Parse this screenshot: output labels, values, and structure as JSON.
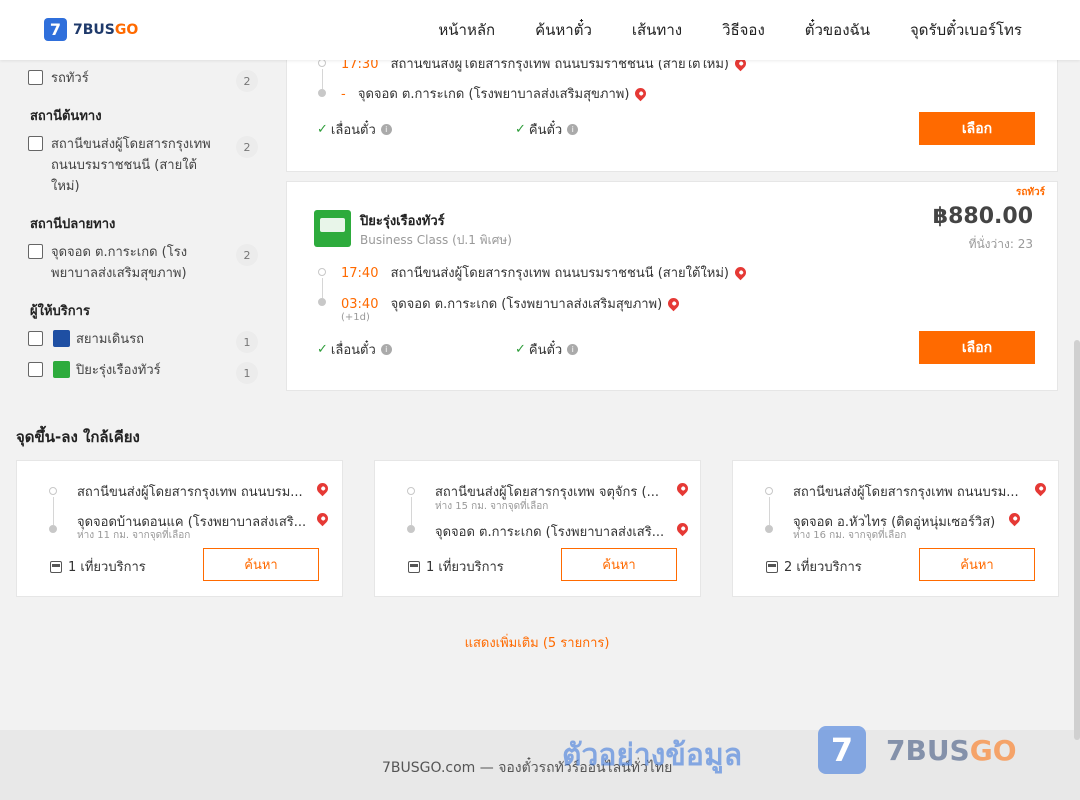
{
  "header": {
    "logo_badge": "7",
    "logo_text_main": "7BUS",
    "logo_text_accent": "GO",
    "nav": [
      "หน้าหลัก",
      "ค้นหาตั๋ว",
      "เส้นทาง",
      "วิธีจอง",
      "ตั๋วของฉัน",
      "จุดรับตั๋วเบอร์โทร"
    ]
  },
  "filters": {
    "type_item": {
      "label": "รถทัวร์",
      "count": "2"
    },
    "origin_title": "สถานีต้นทาง",
    "origin_item": {
      "label": "สถานีขนส่งผู้โดยสารกรุงเทพ ถนนบรมราชชนนี (สายใต้ใหม่)",
      "count": "2"
    },
    "dest_title": "สถานีปลายทาง",
    "dest_item": {
      "label": "จุดจอด ต.การะเกด (โรงพยาบาลส่งเสริมสุขภาพ)",
      "count": "2"
    },
    "operator_title": "ผู้ให้บริการ",
    "operators": [
      {
        "label": "สยามเดินรถ",
        "count": "1"
      },
      {
        "label": "ปิยะรุ่งเรืองทัวร์",
        "count": "1"
      }
    ]
  },
  "card1": {
    "depart_time": "17:30",
    "depart_stop": "สถานีขนส่งผู้โดยสารกรุงเทพ ถนนบรมราชชนนี (สายใต้ใหม่)",
    "arrive_time": "-",
    "arrive_stop": "จุดจอด ต.การะเกด (โรงพยาบาลส่งเสริมสุขภาพ)",
    "feature_reschedule": "เลื่อนตั๋ว",
    "feature_refund": "คืนตั๋ว",
    "select_label": "เลือก"
  },
  "card2": {
    "tag": "รถทัวร์",
    "operator": "ปิยะรุ่งเรืองทัวร์",
    "class": "Business Class (ป.1 พิเศษ)",
    "price": "฿880.00",
    "seats": "ที่นั่งว่าง: 23",
    "depart_time": "17:40",
    "depart_stop": "สถานีขนส่งผู้โดยสารกรุงเทพ ถนนบรมราชชนนี (สายใต้ใหม่)",
    "arrive_time": "03:40",
    "arrive_note": "(+1d)",
    "arrive_stop": "จุดจอด ต.การะเกด (โรงพยาบาลส่งเสริมสุขภาพ)",
    "feature_reschedule": "เลื่อนตั๋ว",
    "feature_refund": "คืนตั๋ว",
    "select_label": "เลือก"
  },
  "nearby": {
    "title": "จุดขึ้น-ลง ใกล้เคียง",
    "search_label": "ค้นหา",
    "cards": [
      {
        "from": "สถานีขนส่งผู้โดยสารกรุงเทพ ถนนบรม...",
        "from_dist": "",
        "to": "จุดจอดบ้านดอนแค (โรงพยาบาลส่งเสริ...",
        "to_dist": "ห่าง 11 กม. จากจุดที่เลือก",
        "trips": "1 เที่ยวบริการ"
      },
      {
        "from": "สถานีขนส่งผู้โดยสารกรุงเทพ จตุจักร (...",
        "from_dist": "ห่าง 15 กม. จากจุดที่เลือก",
        "to": "จุดจอด ต.การะเกด (โรงพยาบาลส่งเสริ...",
        "to_dist": "",
        "trips": "1 เที่ยวบริการ"
      },
      {
        "from": "สถานีขนส่งผู้โดยสารกรุงเทพ ถนนบรม...",
        "from_dist": "",
        "to": "จุดจอด อ.หัวไทร (ติดอู่หนุ่มเซอร์วิส)",
        "to_dist": "ห่าง 16 กม. จากจุดที่เลือก",
        "trips": "2 เที่ยวบริการ"
      }
    ],
    "show_more": "แสดงเพิ่มเติม (5 รายการ)"
  },
  "footer": {
    "text": "7BUSGO.com — จองตั๋วรถทัวร์ออนไลน์ทั่วไทย",
    "watermark": "ตัวอย่างข้อมูล",
    "wm_badge": "7",
    "wm_main": "7BUS",
    "wm_accent": "GO"
  },
  "colors": {
    "accent": "#ff6a00",
    "brand": "#2f6fdb",
    "check": "#2e9d3a",
    "pin": "#e53935"
  }
}
